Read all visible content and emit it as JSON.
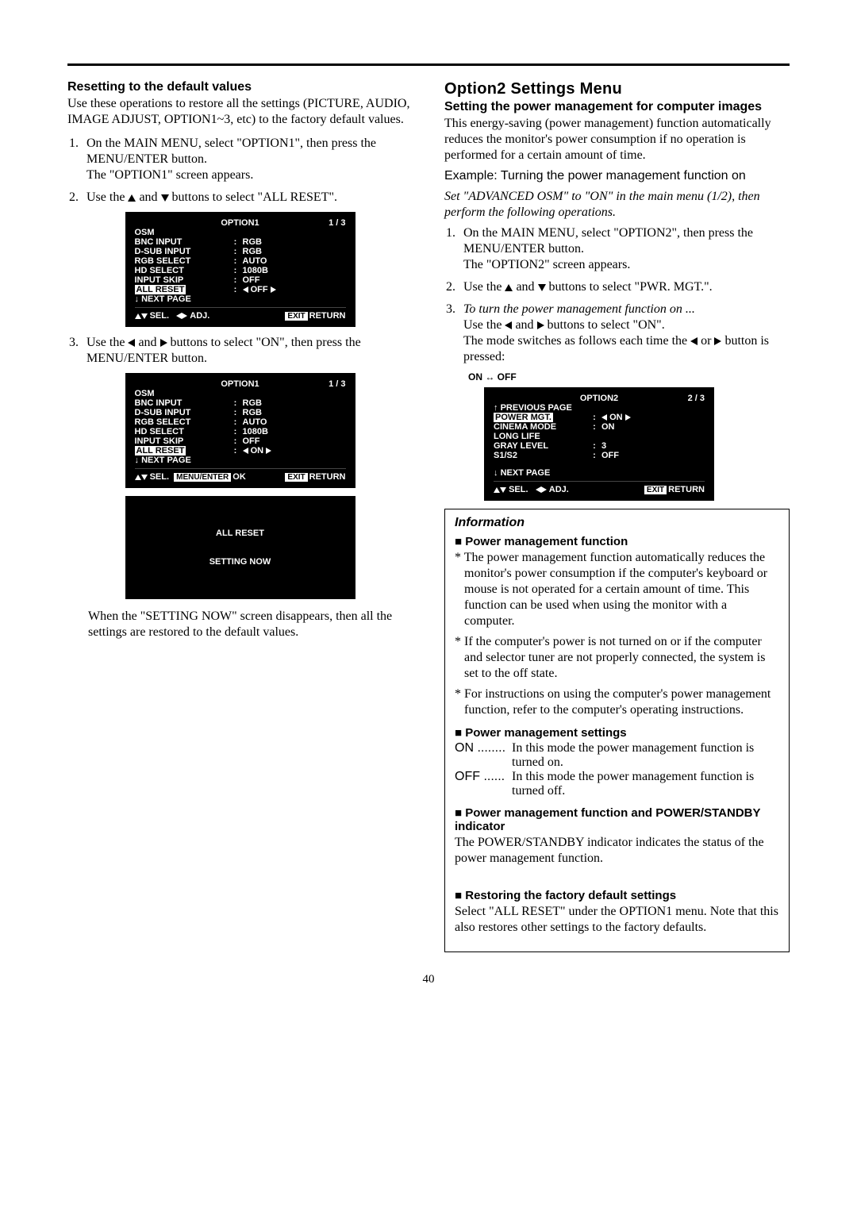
{
  "left": {
    "heading": "Resetting to the default values",
    "intro": "Use these operations to restore all the settings (PICTURE, AUDIO, IMAGE  ADJUST, OPTION1~3, etc) to the factory default values.",
    "step1a": "On the MAIN MENU, select \"OPTION1\", then press the MENU/ENTER button.",
    "step1b": "The \"OPTION1\" screen appears.",
    "step2": "Use the ▲ and ▼ buttons to select \"ALL RESET\".",
    "step3": "Use the ◀ and ▶ buttons to select \"ON\", then press the MENU/ENTER button.",
    "closing": "When the \"SETTING NOW\" screen disappears, then all the settings are restored to the default values."
  },
  "right": {
    "title": "Option2 Settings Menu",
    "heading": "Setting the power management for computer images",
    "intro": "This energy-saving (power management) function automatically reduces the monitor's power consumption if no operation is performed for a certain amount of time.",
    "example": "Example: Turning the power management function on",
    "advosm": "Set \"ADVANCED OSM\" to \"ON\" in the main menu (1/2), then perform the following operations.",
    "step1a": "On the MAIN MENU, select \"OPTION2\", then press the MENU/ENTER button.",
    "step1b": "The \"OPTION2\" screen appears.",
    "step2": "Use the ▲ and ▼ buttons to select \"PWR. MGT.\".",
    "step3a": "To turn the power management function on ...",
    "step3b": "Use the ◀ and ▶ buttons to select \"ON\".",
    "step3c": "The mode switches as follows each time the ◀ or ▶ button is pressed:",
    "toggle": "ON ↔ OFF"
  },
  "osd1": {
    "title": "OPTION1",
    "page": "1 / 3",
    "rows": [
      {
        "l": "OSM"
      },
      {
        "l": "BNC INPUT",
        "v": "RGB"
      },
      {
        "l": "D-SUB INPUT",
        "v": "RGB"
      },
      {
        "l": "RGB SELECT",
        "v": "AUTO"
      },
      {
        "l": "HD SELECT",
        "v": "1080B"
      },
      {
        "l": "INPUT SKIP",
        "v": "OFF"
      }
    ],
    "all_reset": "ALL RESET",
    "all_reset_val": "OFF",
    "next": "NEXT PAGE",
    "sel": "SEL.",
    "adj": "ADJ.",
    "exit": "EXIT",
    "return": "RETURN"
  },
  "osd2": {
    "title": "OPTION1",
    "page": "1 / 3",
    "rows": [
      {
        "l": "OSM"
      },
      {
        "l": "BNC INPUT",
        "v": "RGB"
      },
      {
        "l": "D-SUB INPUT",
        "v": "RGB"
      },
      {
        "l": "RGB SELECT",
        "v": "AUTO"
      },
      {
        "l": "HD SELECT",
        "v": "1080B"
      },
      {
        "l": "INPUT SKIP",
        "v": "OFF"
      }
    ],
    "all_reset": "ALL RESET",
    "all_reset_val": "ON",
    "next": "NEXT PAGE",
    "sel": "SEL.",
    "menuenter": "MENU/ENTER",
    "ok": "OK",
    "exit": "EXIT",
    "return": "RETURN"
  },
  "osd_reset": {
    "title": "ALL RESET",
    "setting": "SETTING NOW"
  },
  "osd3": {
    "title": "OPTION2",
    "page": "2 / 3",
    "prev": "PREVIOUS PAGE",
    "power_mgt": "POWER MGT.",
    "power_mgt_val": "ON",
    "rows": [
      {
        "l": "CINEMA MODE",
        "v": "ON"
      },
      {
        "l": "LONG LIFE"
      },
      {
        "l": "GRAY LEVEL",
        "v": "3"
      },
      {
        "l": "S1/S2",
        "v": "OFF"
      }
    ],
    "next": "NEXT PAGE",
    "sel": "SEL.",
    "adj": "ADJ.",
    "exit": "EXIT",
    "return": "RETURN"
  },
  "info": {
    "title": "Information",
    "h1": "Power management function",
    "p1": "* The power management function automatically reduces the monitor's power consumption if the computer's keyboard or mouse is not operated for a certain amount of time. This function can be used when using the monitor with a computer.",
    "p2": "* If the computer's power is not turned on or if the computer and selector tuner are not properly connected, the system is set to the off state.",
    "p3": "* For instructions on using the computer's power management function, refer to the computer's operating instructions.",
    "h2": "Power management settings",
    "on_l": "ON ........",
    "on_d": "In this mode the power management function is turned on.",
    "off_l": "OFF ......",
    "off_d": "In this mode the power management function is turned off.",
    "h3": "Power management function and POWER/STANDBY indicator",
    "p4": "The POWER/STANDBY indicator indicates the status of the power management function.",
    "h4": "Restoring the factory default settings",
    "p5": "Select \"ALL RESET\" under the OPTION1 menu. Note that this also restores other settings to the factory defaults."
  },
  "pagenum": "40"
}
